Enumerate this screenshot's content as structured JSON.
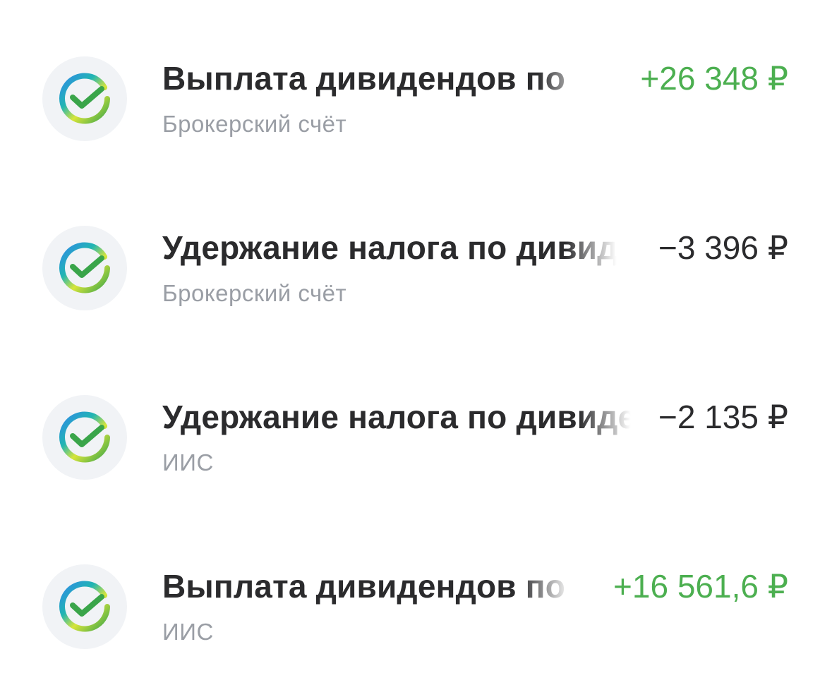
{
  "colors": {
    "positive": "#4caf50",
    "negative": "#2b2b2d",
    "subtitle": "#9a9ea5",
    "avatar_bg": "#f1f3f6"
  },
  "operations": [
    {
      "icon": "sber-logo-icon",
      "title": "Выплата дивидендов по",
      "subtitle": "Брокерский счёт",
      "amount": "+26 348 ₽",
      "sign": "positive"
    },
    {
      "icon": "sber-logo-icon",
      "title": "Удержание налога по дивидендам",
      "subtitle": "Брокерский счёт",
      "amount": "−3 396 ₽",
      "sign": "negative"
    },
    {
      "icon": "sber-logo-icon",
      "title": "Удержание налога по дивидендам",
      "subtitle": "ИИС",
      "amount": "−2 135 ₽",
      "sign": "negative"
    },
    {
      "icon": "sber-logo-icon",
      "title": "Выплата дивидендов по",
      "subtitle": "ИИС",
      "amount": "+16 561,6 ₽",
      "sign": "positive"
    }
  ]
}
